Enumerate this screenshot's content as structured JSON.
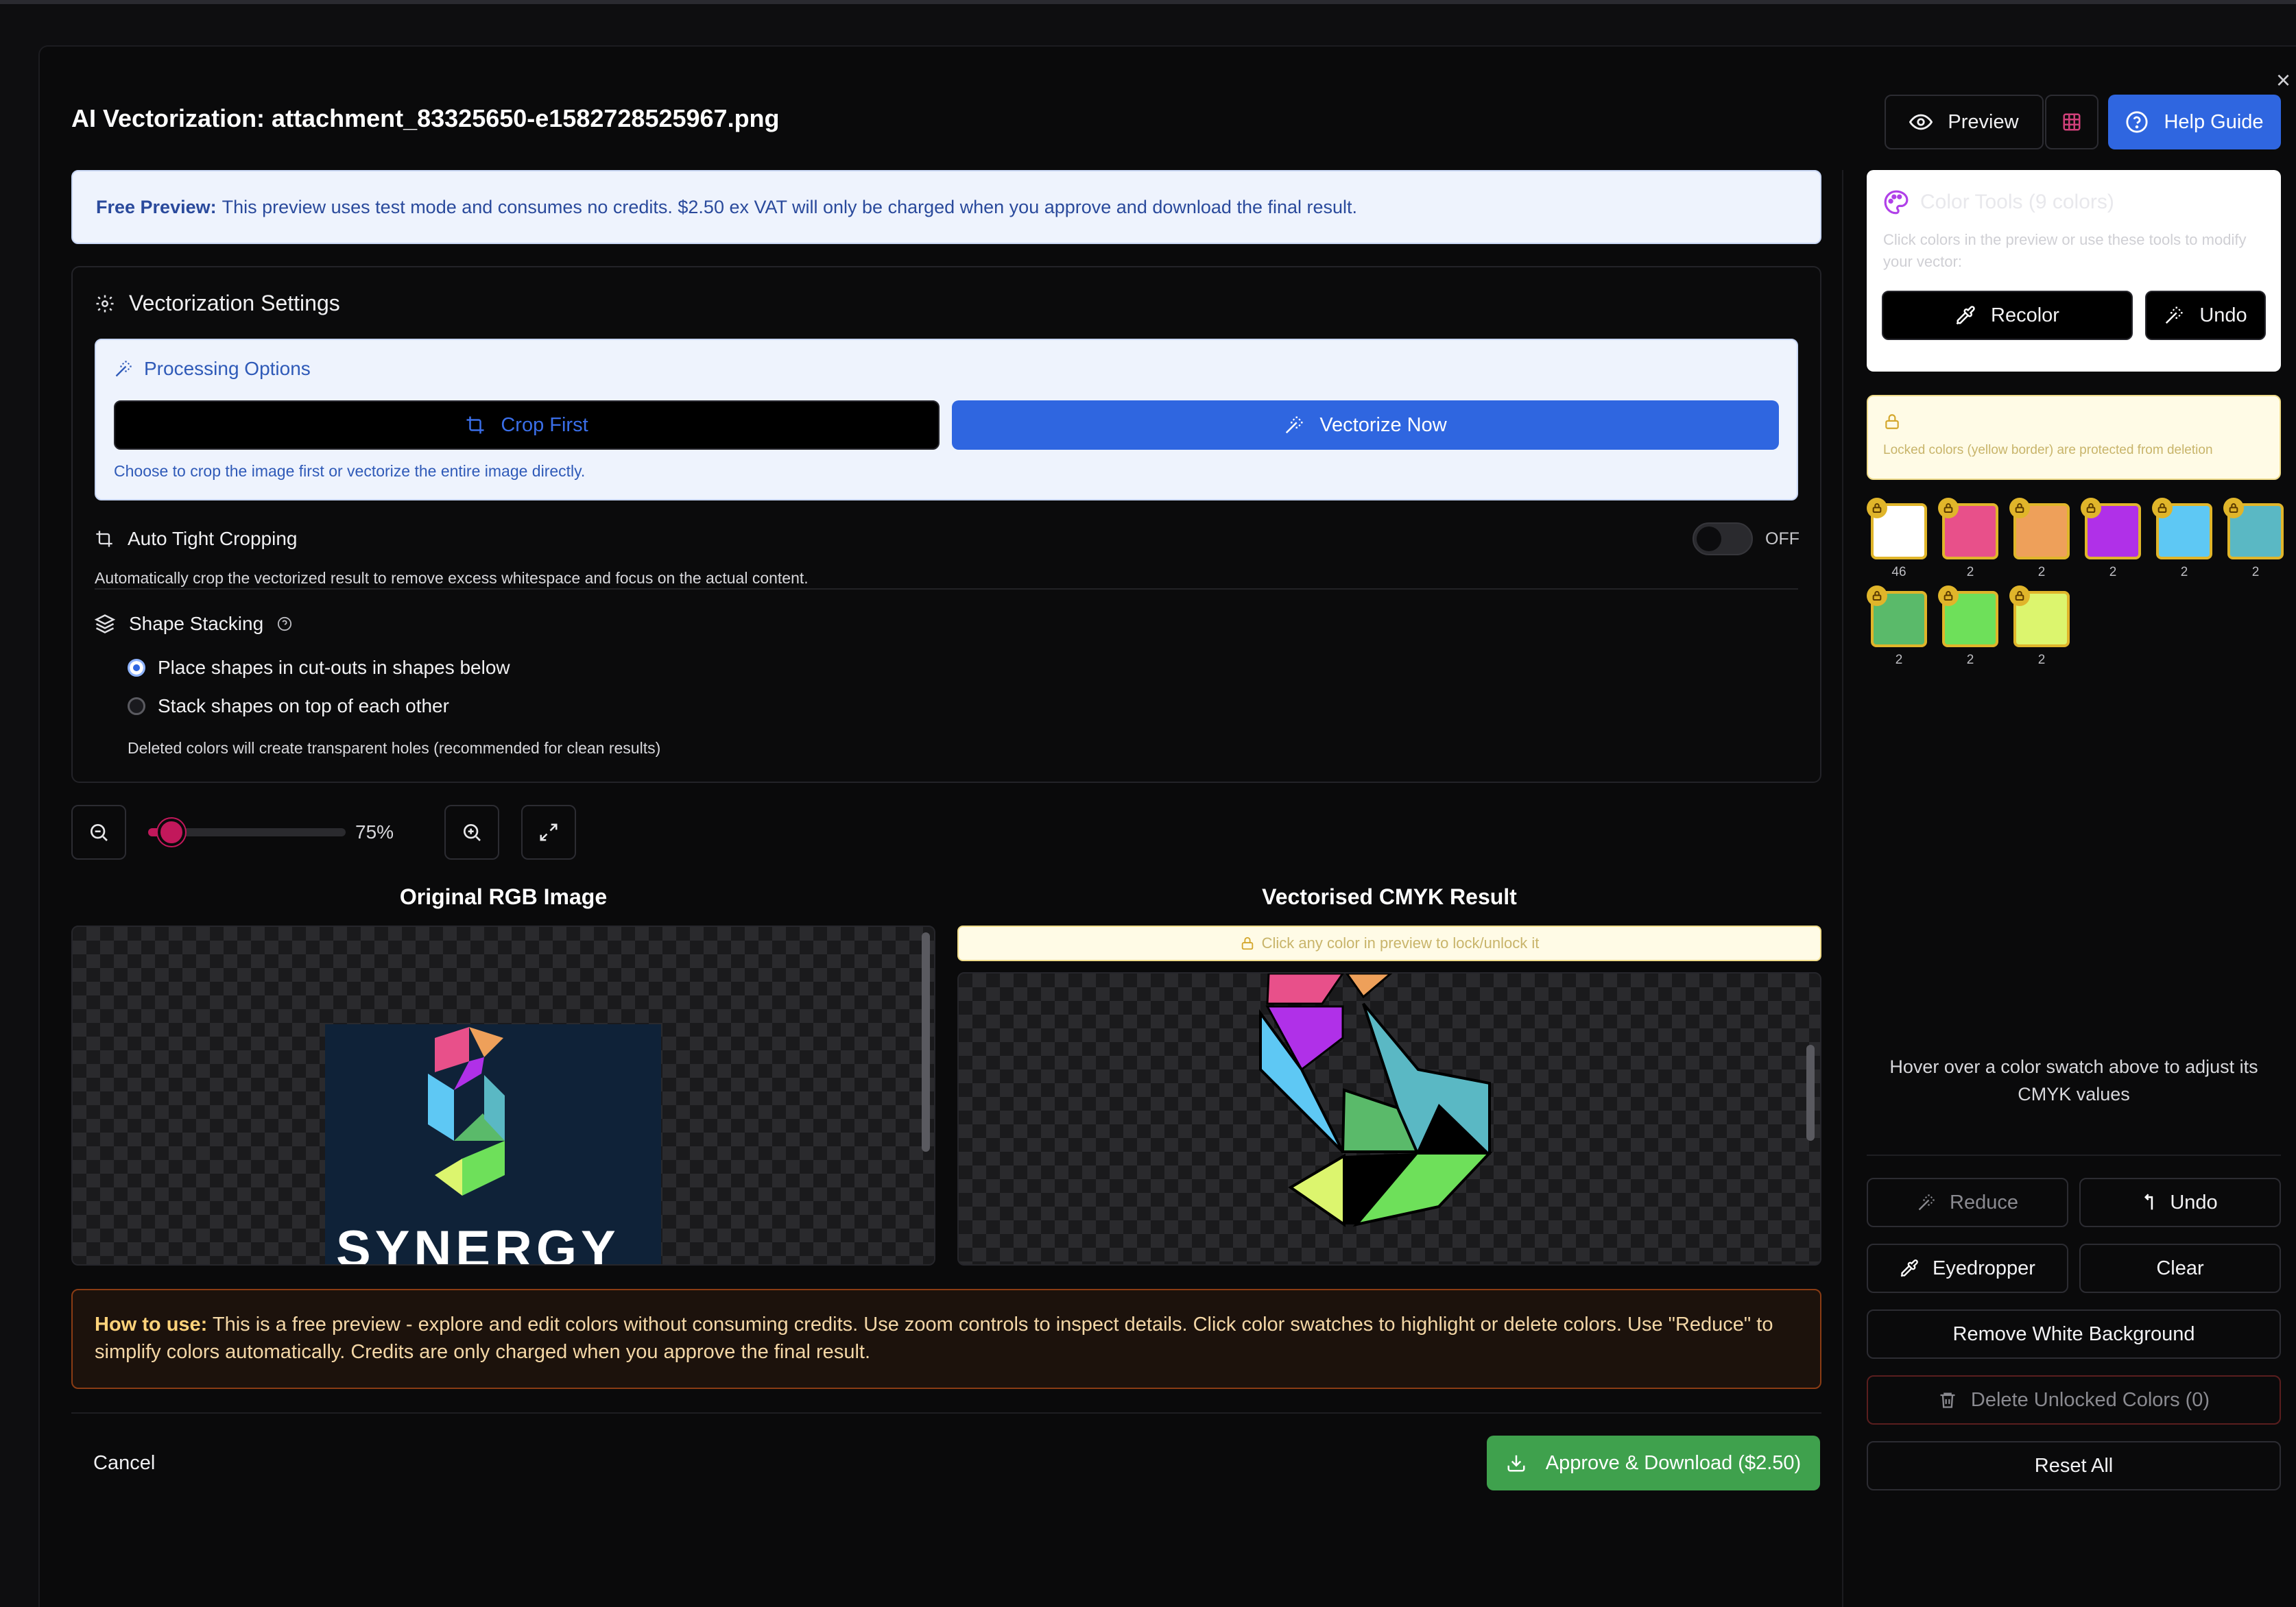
{
  "modal": {
    "title": "AI Vectorization: attachment_83325650-e1582728525967.png",
    "close": "×",
    "header_buttons": {
      "preview": "Preview",
      "help": "Help Guide"
    }
  },
  "notice": {
    "label": "Free Preview:",
    "text": "This preview uses test mode and consumes no credits. $2.50 ex VAT will only be charged when you approve and download the final result."
  },
  "settings": {
    "title": "Vectorization Settings",
    "processing": {
      "title": "Processing Options",
      "crop_first": "Crop First",
      "vectorize_now": "Vectorize Now",
      "hint": "Choose to crop the image first or vectorize the entire image directly."
    },
    "auto_crop": {
      "title": "Auto Tight Cropping",
      "state": "OFF",
      "desc": "Automatically crop the vectorized result to remove excess whitespace and focus on the actual content."
    },
    "stacking": {
      "title": "Shape Stacking",
      "options": [
        "Place shapes in cut-outs in shapes below",
        "Stack shapes on top of each other"
      ],
      "selected_index": 0,
      "note": "Deleted colors will create transparent holes (recommended for clean results)"
    }
  },
  "zoom": {
    "level": "75%",
    "fraction": 0.12
  },
  "previews": {
    "original_title": "Original RGB Image",
    "result_title": "Vectorised CMYK Result",
    "lock_hint": "Click any color in preview to lock/unlock it",
    "logo_text": "SYNERGY"
  },
  "howto": {
    "label": "How to use:",
    "text": "This is a free preview - explore and edit colors without consuming credits. Use zoom controls to inspect details. Click color swatches to highlight or delete colors. Use \"Reduce\" to simplify colors automatically. Credits are only charged when you approve the final result."
  },
  "footer": {
    "cancel": "Cancel",
    "approve": "Approve & Download ($2.50)"
  },
  "sidebar": {
    "color_tools": {
      "title": "Color Tools (9 colors)",
      "desc": "Click colors in the preview or use these tools to modify your vector:",
      "recolor": "Recolor",
      "undo": "Undo"
    },
    "locked_note": "Locked colors (yellow border) are protected from deletion",
    "swatches": [
      {
        "color": "#ffffff",
        "count": "46"
      },
      {
        "color": "#e8508a",
        "count": "2"
      },
      {
        "color": "#eea05a",
        "count": "2"
      },
      {
        "color": "#b030e8",
        "count": "2"
      },
      {
        "color": "#5ec8f4",
        "count": "2"
      },
      {
        "color": "#5ab8c4",
        "count": "2"
      },
      {
        "color": "#5aba6a",
        "count": "2"
      },
      {
        "color": "#6ee05a",
        "count": "2"
      },
      {
        "color": "#dcf56e",
        "count": "2"
      }
    ],
    "hover_hint": "Hover over a color swatch above to adjust its CMYK values",
    "tools": {
      "reduce": "Reduce",
      "undo": "Undo",
      "eyedropper": "Eyedropper",
      "clear": "Clear",
      "remove_white": "Remove White Background",
      "delete_unlocked": "Delete Unlocked Colors (0)",
      "reset_all": "Reset All"
    }
  }
}
